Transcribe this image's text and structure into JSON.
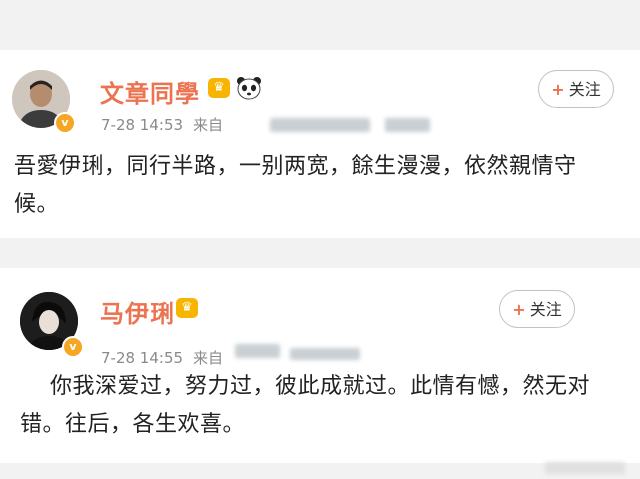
{
  "posts": [
    {
      "user": "文章同學",
      "time": "7-28 14:53",
      "source": "来自",
      "follow_label": "关注",
      "follow_icon": "plus-icon",
      "text": "吾愛伊琍，同行半路，一别两宽，餘生漫漫，依然親情守候。",
      "badges": [
        "crown-icon",
        "panda-icon"
      ],
      "colors": {
        "name": "#eb7350",
        "badge": "#f7b500",
        "verified": "#f5a623"
      }
    },
    {
      "user": "马伊琍",
      "time": "7-28 14:55",
      "source": "来自",
      "follow_label": "关注",
      "follow_icon": "plus-icon",
      "text": "你我深爱过，努力过，彼此成就过。此情有憾，然无对错。往后，各生欢喜。",
      "badges": [
        "crown-icon"
      ],
      "colors": {
        "name": "#eb7350",
        "badge": "#f7b500",
        "verified": "#f5a623"
      }
    }
  ]
}
